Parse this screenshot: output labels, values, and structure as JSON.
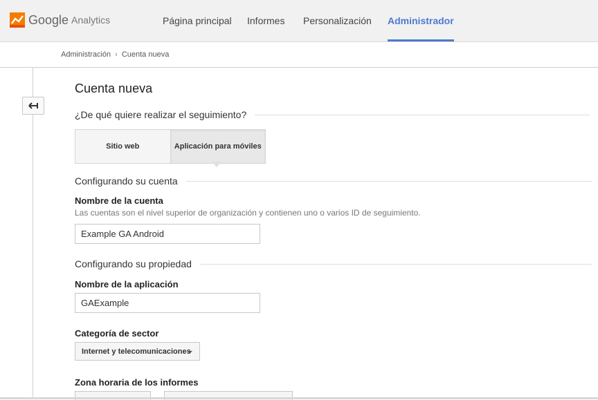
{
  "app": {
    "brand_google": "Google",
    "brand_analytics": "Analytics"
  },
  "nav": [
    {
      "label": "Página principal"
    },
    {
      "label": "Informes"
    },
    {
      "label": "Personalización"
    },
    {
      "label": "Administrador",
      "active": true
    }
  ],
  "breadcrumb": {
    "root": "Administración",
    "separator": "›",
    "current": "Cuenta nueva"
  },
  "page": {
    "title": "Cuenta nueva"
  },
  "tracking": {
    "question": "¿De qué quiere realizar el seguimiento?",
    "options": [
      "Sitio web",
      "Aplicación para móviles"
    ],
    "selected": "Aplicación para móviles"
  },
  "account_section": {
    "heading": "Configurando su cuenta",
    "name_label": "Nombre de la cuenta",
    "name_help": "Las cuentas son el nivel superior de organización y contienen uno o varios ID de seguimiento.",
    "name_value": "Example GA Android"
  },
  "property_section": {
    "heading": "Configurando su propiedad",
    "app_name_label": "Nombre de la aplicación",
    "app_name_value": "GAExample",
    "industry_label": "Categoría de sector",
    "industry_value": "Internet y telecomunicaciones",
    "timezone_label": "Zona horaria de los informes"
  },
  "colors": {
    "accent": "#4d7ad0",
    "header_bg": "#f1f1f1",
    "logo_orange": "#f57c00"
  },
  "icons": {
    "logo": "analytics-logo-icon",
    "back": "back-arrow-icon",
    "dropdown": "caret-down-icon"
  }
}
